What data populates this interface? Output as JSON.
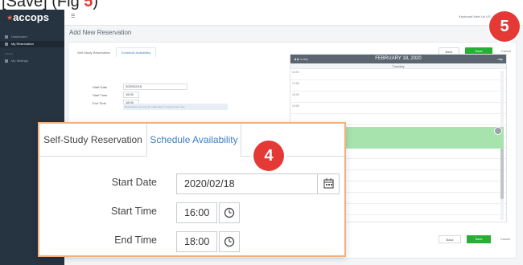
{
  "caption": {
    "prefix": "[",
    "word": "Save",
    "suffix": "] (Fig ",
    "step": "5",
    "close": ")"
  },
  "app": {
    "logo": "accops",
    "nav": [
      {
        "label": "Dashboard"
      },
      {
        "label": "My Reservation"
      },
      {
        "label": "My Settings"
      }
    ],
    "nav_group": "TOOLS",
    "topbar_right": "Keyboard Kate Lin US  ·  Welcome"
  },
  "page": {
    "title": "Add New Reservation",
    "tabs": [
      "Self-Study Reservation",
      "Schedule Availability"
    ],
    "start_date_label": "Start Date",
    "start_date": "2020/02/18",
    "start_time_label": "Start Time",
    "start_time": "16:00",
    "end_time_label": "End Time",
    "end_time": "18:00",
    "note": "Reservation can only be made after 4 minutes from now",
    "back_label": "Back",
    "save_label": "Save",
    "cancel_label": "Cancel"
  },
  "calendar": {
    "today_label": "today",
    "title": "FEBRUARY 18, 2020",
    "view_label": "day",
    "day_label": "Tuesday",
    "times": [
      "11:00",
      "12:00",
      "13:00",
      "14:00"
    ]
  },
  "overlay": {
    "tabs": [
      "Self-Study Reservation",
      "Schedule Availability"
    ],
    "start_date_label": "Start Date",
    "start_date": "2020/02/18",
    "start_time_label": "Start Time",
    "start_time": "16:00",
    "end_time_label": "End Time",
    "end_time": "18:00"
  },
  "badges": {
    "step4": "4",
    "step5": "5"
  },
  "colors": {
    "accent_save": "#27ae35",
    "badge": "#e53935",
    "overlay_border": "#f3b07c",
    "selected_slot": "#a7e3ad"
  }
}
